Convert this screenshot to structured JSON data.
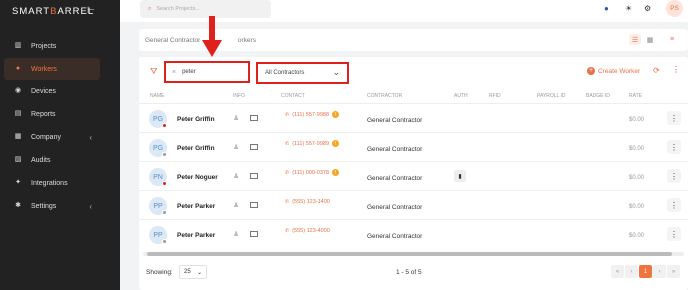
{
  "logo": {
    "part1": "SMART",
    "part2": "B",
    "part3": "ARREL"
  },
  "sidebar": {
    "items": [
      {
        "label": "Projects",
        "icon": "projects-icon",
        "glyph": "▥"
      },
      {
        "label": "Workers",
        "icon": "workers-icon",
        "glyph": "●"
      },
      {
        "label": "Devices",
        "icon": "devices-icon",
        "glyph": "◉"
      },
      {
        "label": "Reports",
        "icon": "reports-icon",
        "glyph": "▤"
      },
      {
        "label": "Company",
        "icon": "company-icon",
        "glyph": "▦"
      },
      {
        "label": "Audits",
        "icon": "audits-icon",
        "glyph": "▨"
      },
      {
        "label": "Integrations",
        "icon": "integrations-icon",
        "glyph": "✦"
      },
      {
        "label": "Settings",
        "icon": "settings-icon",
        "glyph": "✱"
      }
    ],
    "active": "Workers"
  },
  "search": {
    "placeholder": "Search Projects..."
  },
  "user": {
    "initials": "PS"
  },
  "breadcrumb": {
    "part1": "General Contractor",
    "part2": "orkers"
  },
  "filter": {
    "value": "peter",
    "contractor": "All Contractors"
  },
  "create_label": "Create Worker",
  "columns": [
    "NAME",
    "INFO",
    "CONTACT",
    "CONTRACTOR",
    "AUTH",
    "RFID",
    "PAYROLL ID",
    "BADGE ID",
    "RATE"
  ],
  "workers": [
    {
      "initials": "PG",
      "name": "Peter Griffin",
      "phone": "(111) 557-9988",
      "contractor": "General Contractor",
      "rate": "$0.00",
      "status": "red",
      "has_auth": false,
      "has_badge": true
    },
    {
      "initials": "PG",
      "name": "Peter Griffin",
      "phone": "(111) 557-9989",
      "contractor": "General Contractor",
      "rate": "$0.00",
      "status": "grey",
      "has_auth": false,
      "has_badge": true
    },
    {
      "initials": "PN",
      "name": "Peter Noguer",
      "phone": "(111) 000-0378",
      "contractor": "General Contractor",
      "rate": "$0.00",
      "status": "red",
      "has_auth": true,
      "has_badge": true
    },
    {
      "initials": "PP",
      "name": "Peter Parker",
      "phone": "(555) 123-1400",
      "contractor": "General Contractor",
      "rate": "$0.00",
      "status": "grey",
      "has_auth": false,
      "has_badge": false
    },
    {
      "initials": "PP",
      "name": "Peter Parker",
      "phone": "(555) 123-4000",
      "contractor": "General Contractor",
      "rate": "$0.00",
      "status": "grey",
      "has_auth": false,
      "has_badge": false
    }
  ],
  "footer": {
    "showing_label": "Showing:",
    "per_page": "25",
    "range": "1 - 5 of 5",
    "current_page": "1"
  },
  "colors": {
    "accent": "#e8704a",
    "annotation": "#e0201a",
    "sidebar_bg": "#222222"
  }
}
